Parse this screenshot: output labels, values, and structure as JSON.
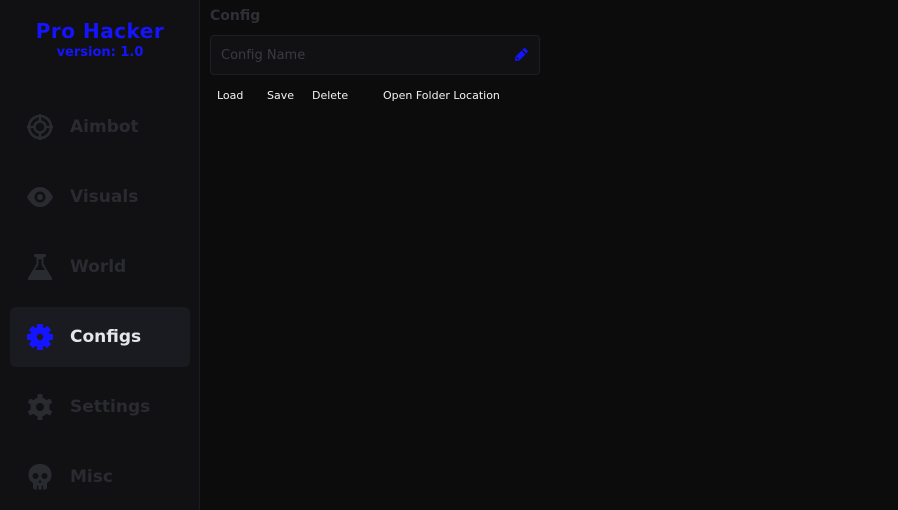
{
  "brand": {
    "title": "Pro Hacker",
    "version": "version: 1.0",
    "accent_color": "#1414ff"
  },
  "sidebar": {
    "items": [
      {
        "label": "Aimbot",
        "icon": "crosshair-icon",
        "active": false
      },
      {
        "label": "Visuals",
        "icon": "eye-icon",
        "active": false
      },
      {
        "label": "World",
        "icon": "flask-icon",
        "active": false
      },
      {
        "label": "Configs",
        "icon": "cog-icon",
        "active": true
      },
      {
        "label": "Settings",
        "icon": "gear-icon",
        "active": false
      },
      {
        "label": "Misc",
        "icon": "skull-icon",
        "active": false
      }
    ]
  },
  "main": {
    "section_title": "Config",
    "config_name": {
      "value": "",
      "placeholder": "Config Name"
    },
    "buttons": {
      "load": "Load",
      "save": "Save",
      "delete": "Delete",
      "open_folder": "Open Folder Location"
    }
  }
}
